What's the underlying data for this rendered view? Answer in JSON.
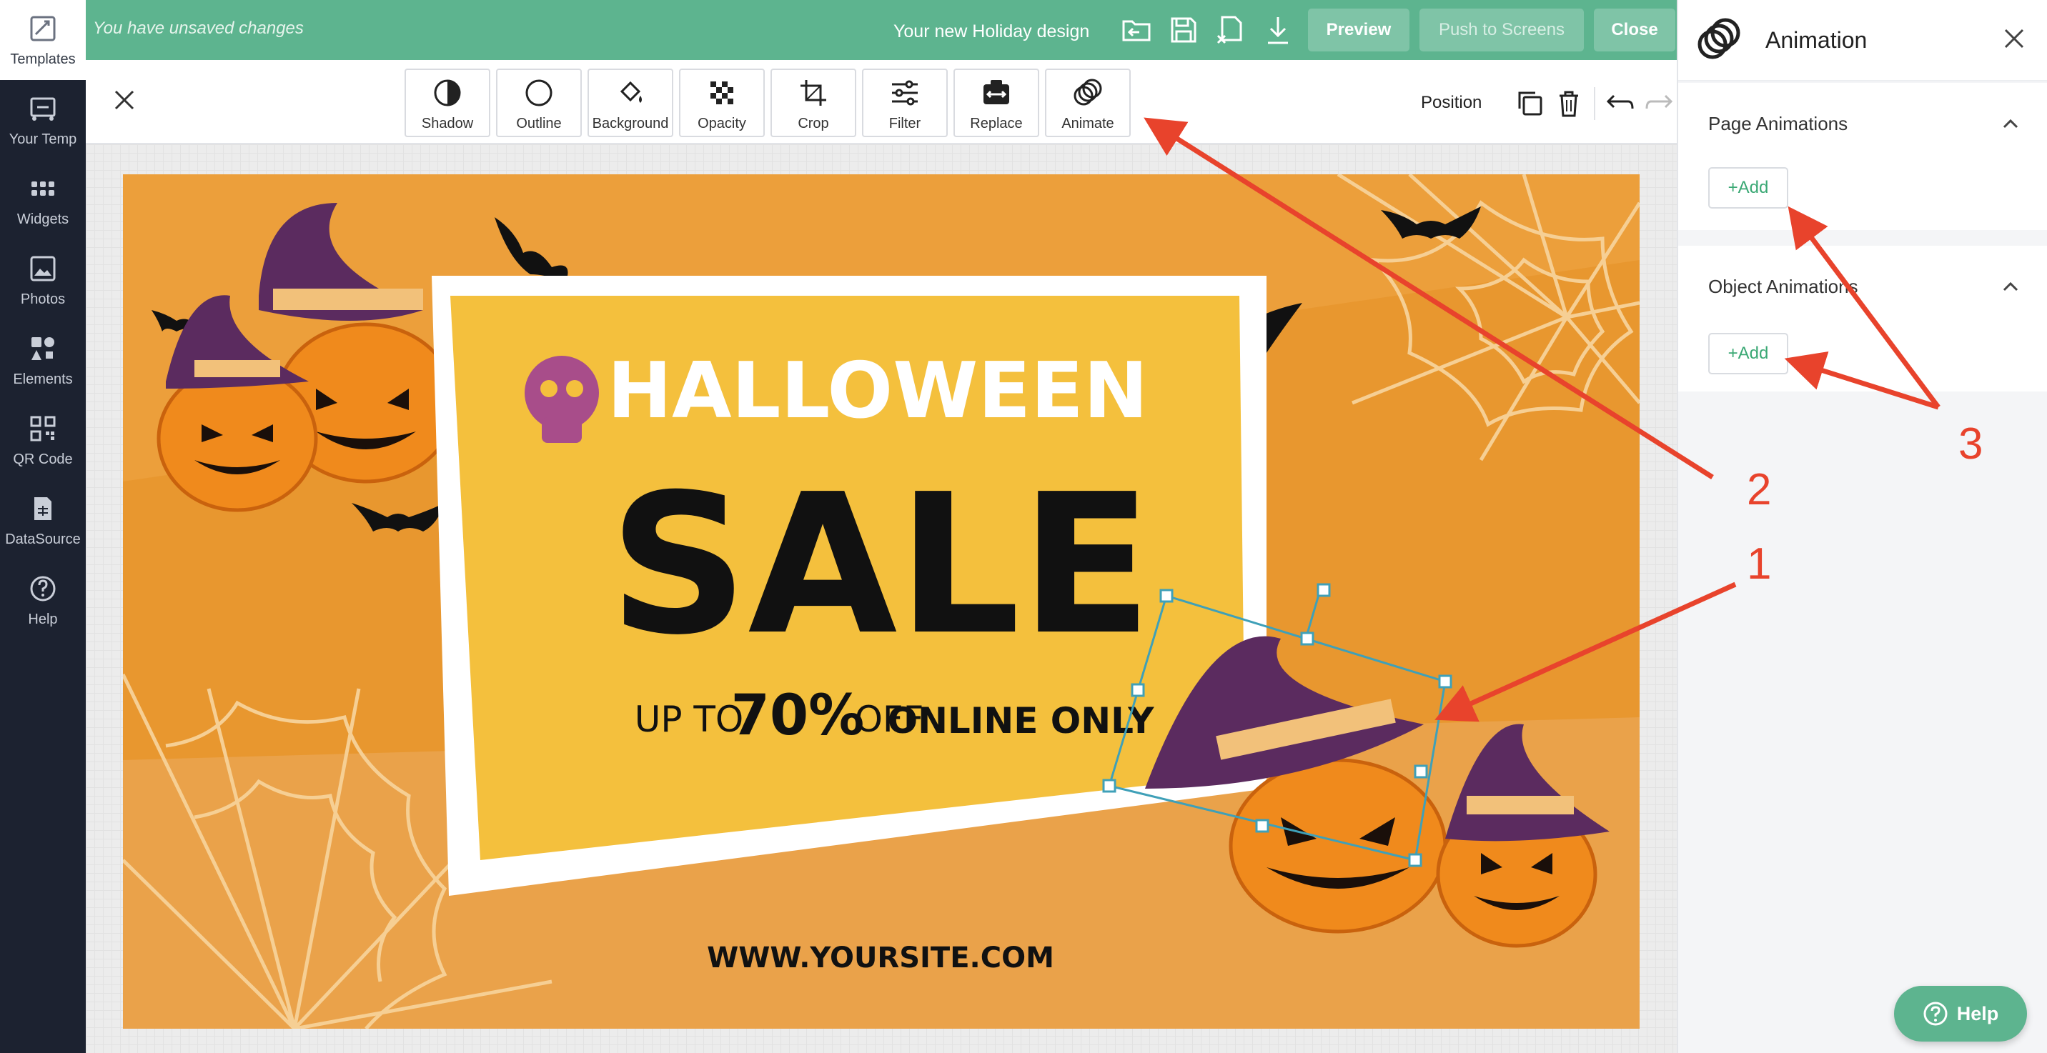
{
  "sidebar": {
    "items": [
      {
        "label": "Templates",
        "icon": "templates-icon",
        "active": true
      },
      {
        "label": "Your Temp",
        "icon": "your-templates-icon"
      },
      {
        "label": "Widgets",
        "icon": "widgets-icon"
      },
      {
        "label": "Photos",
        "icon": "photos-icon"
      },
      {
        "label": "Elements",
        "icon": "elements-icon"
      },
      {
        "label": "QR Code",
        "icon": "qr-code-icon"
      },
      {
        "label": "DataSource",
        "icon": "datasource-icon"
      },
      {
        "label": "Help",
        "icon": "help-icon"
      }
    ]
  },
  "topbar": {
    "unsaved": "You have unsaved changes",
    "design_name": "Your new Holiday design",
    "preview_label": "Preview",
    "push_label": "Push to Screens",
    "close_label": "Close",
    "accent": "#5db48f"
  },
  "toolbar": {
    "tools": [
      "Shadow",
      "Outline",
      "Background",
      "Opacity",
      "Crop",
      "Filter",
      "Replace",
      "Animate"
    ],
    "position_label": "Position"
  },
  "design": {
    "headline": "HALLOWEEN",
    "sale": "SALE",
    "up_to": "UP TO",
    "percent": "70%",
    "off": "OFF",
    "online_only": "ONLINE ONLY",
    "website": "WWW.YOURSITE.COM",
    "bg_color": "#e8972f",
    "card_color": "#f4c03d"
  },
  "panel": {
    "title": "Animation",
    "page_animations": "Page Animations",
    "object_animations": "Object Animations",
    "add_label": "+Add"
  },
  "help_button": "Help",
  "annotations": {
    "n1": "1",
    "n2": "2",
    "n3": "3",
    "color": "#e8432c"
  }
}
